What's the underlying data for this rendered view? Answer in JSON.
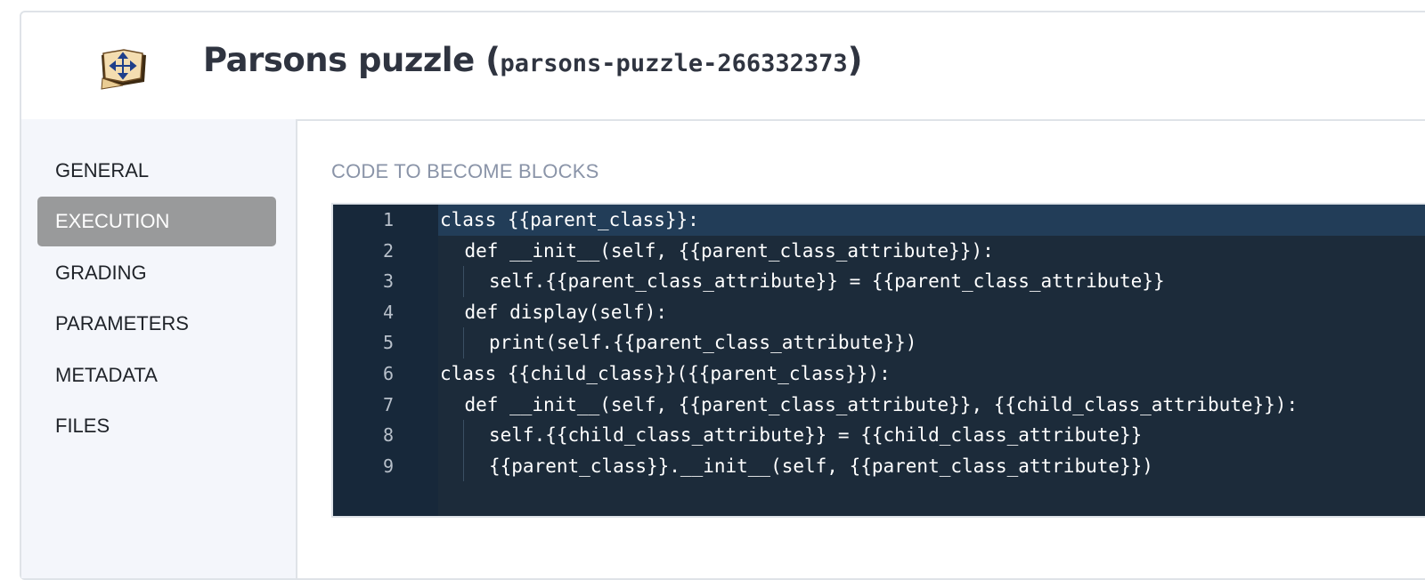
{
  "header": {
    "title": "Parsons puzzle",
    "open_paren": "(",
    "id": "parsons-puzzle-266332373",
    "close_paren": ")",
    "icon": "move-arrows-book-icon"
  },
  "sidebar": {
    "items": [
      {
        "label": "GENERAL",
        "active": false
      },
      {
        "label": "EXECUTION",
        "active": true
      },
      {
        "label": "GRADING",
        "active": false
      },
      {
        "label": "PARAMETERS",
        "active": false
      },
      {
        "label": "METADATA",
        "active": false
      },
      {
        "label": "FILES",
        "active": false
      }
    ]
  },
  "main": {
    "section_label": "CODE TO BECOME BLOCKS",
    "editor": {
      "active_line": 1,
      "lines": [
        {
          "n": "1",
          "indent": 0,
          "text": "class {{parent_class}}:"
        },
        {
          "n": "2",
          "indent": 1,
          "text": "def __init__(self, {{parent_class_attribute}}):"
        },
        {
          "n": "3",
          "indent": 2,
          "text": "self.{{parent_class_attribute}} = {{parent_class_attribute}}"
        },
        {
          "n": "4",
          "indent": 1,
          "text": "def display(self):"
        },
        {
          "n": "5",
          "indent": 2,
          "text": "print(self.{{parent_class_attribute}})"
        },
        {
          "n": "6",
          "indent": 0,
          "text": "class {{child_class}}({{parent_class}}):"
        },
        {
          "n": "7",
          "indent": 1,
          "text": "def __init__(self, {{parent_class_attribute}}, {{child_class_attribute}}):"
        },
        {
          "n": "8",
          "indent": 2,
          "text": "self.{{child_class_attribute}} = {{child_class_attribute}}"
        },
        {
          "n": "9",
          "indent": 2,
          "text": "{{parent_class}}.__init__(self, {{parent_class_attribute}})"
        }
      ]
    }
  },
  "colors": {
    "editor_bg": "#1c2b3a",
    "active_line": "#223d58",
    "nav_active": "#999a9b",
    "section_label": "#8a94a8"
  }
}
